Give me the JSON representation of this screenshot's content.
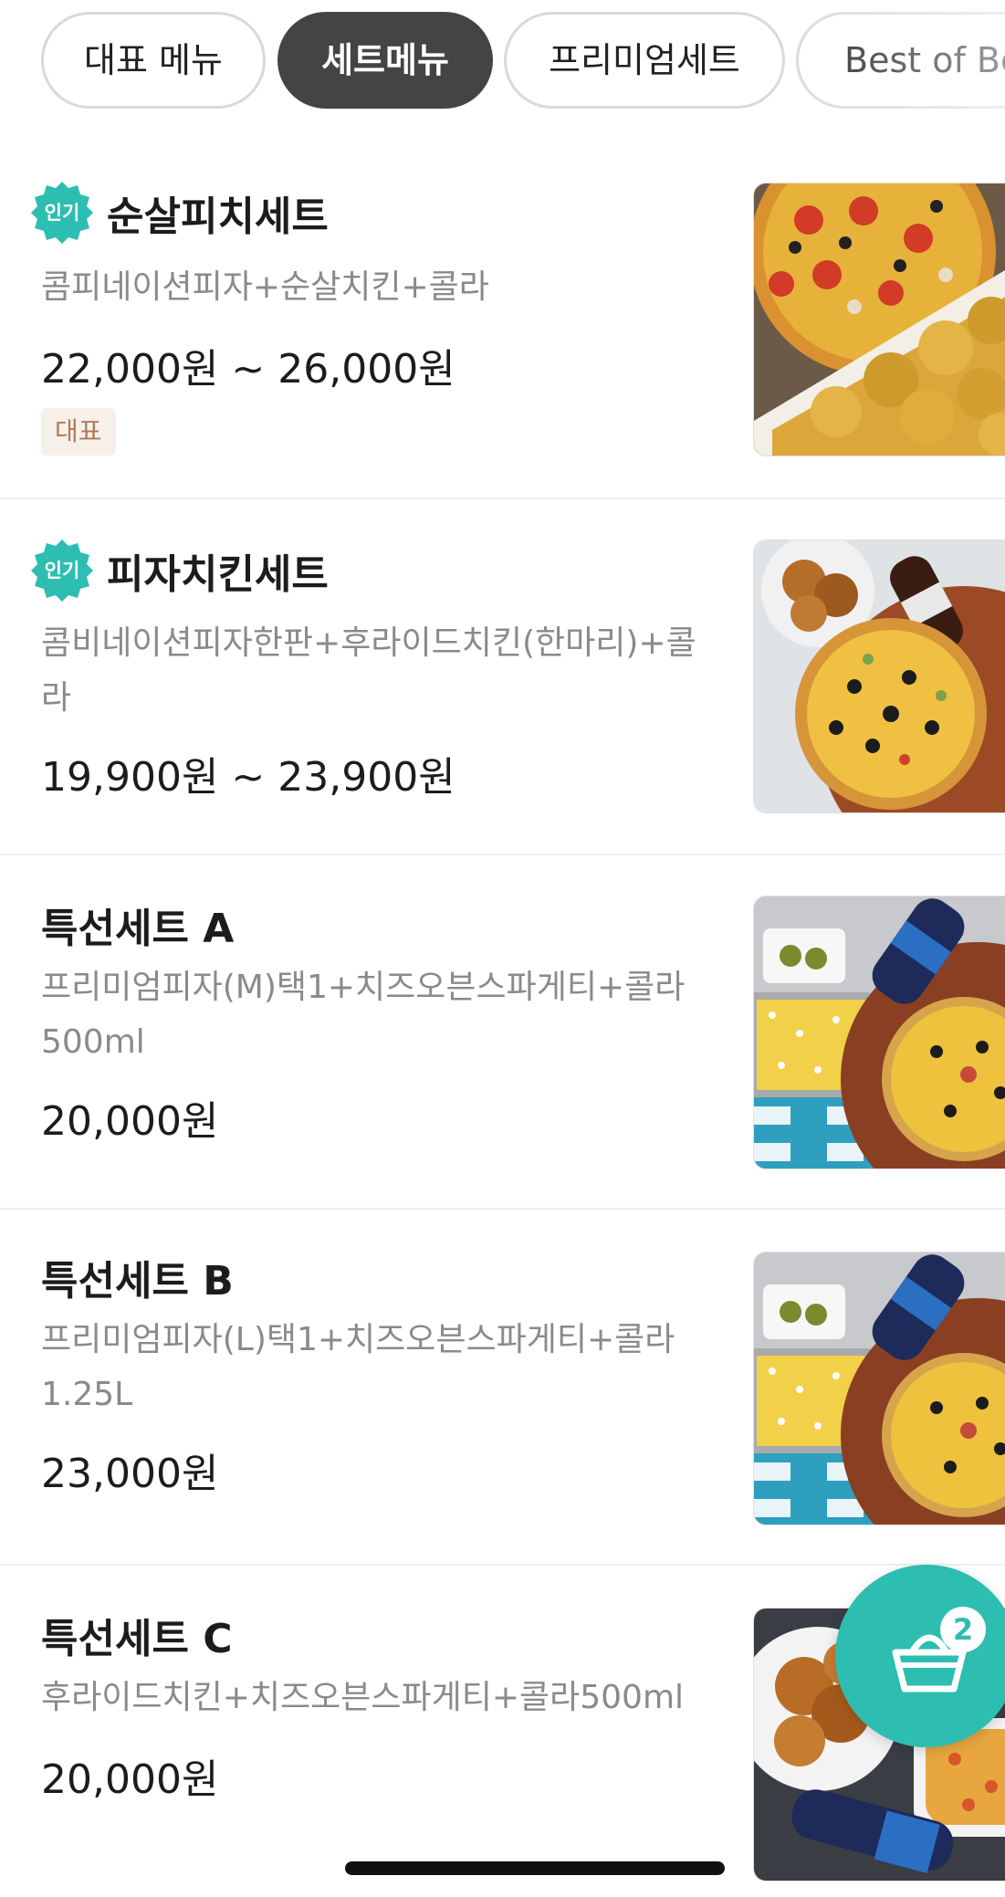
{
  "tabs": [
    {
      "label": "대표 메뉴",
      "active": false
    },
    {
      "label": "세트메뉴",
      "active": true
    },
    {
      "label": "프리미엄세트",
      "active": false
    },
    {
      "label": "Best of Be",
      "active": false
    }
  ],
  "popular_badge": "인기",
  "items": [
    {
      "name": "순살피치세트",
      "popular": true,
      "description": "콤피네이션피자+순살치킨+콜라",
      "price": "22,000원 ~ 26,000원",
      "tag": "대표",
      "image": "pizza-chicken-photo"
    },
    {
      "name": "피자치킨세트",
      "popular": true,
      "description": "콤비네이션피자한판+후라이드치킨(한마리)+콜라",
      "price": "19,900원 ~ 23,900원",
      "image": "pizza-chicken-cola-photo"
    },
    {
      "name": "특선세트 A",
      "popular": false,
      "description": "프리미엄피자(M)택1+치즈오븐스파게티+콜라500ml",
      "price": "20,000원",
      "image": "pizza-spaghetti-cola-photo"
    },
    {
      "name": "특선세트 B",
      "popular": false,
      "description": "프리미엄피자(L)택1+치즈오븐스파게티+콜라1.25L",
      "price": "23,000원",
      "image": "pizza-spaghetti-cola-photo"
    },
    {
      "name": "특선세트 C",
      "popular": false,
      "description": "후라이드치킨+치즈오븐스파게티+콜라500ml",
      "price": "20,000원",
      "image": "chicken-spaghetti-cola-photo"
    }
  ],
  "cart": {
    "count": "2",
    "icon": "basket-icon"
  },
  "colors": {
    "accent": "#2dbdb1",
    "active_chip": "#444444",
    "tag_bg": "#f6f0ea",
    "tag_text": "#b07a55"
  }
}
